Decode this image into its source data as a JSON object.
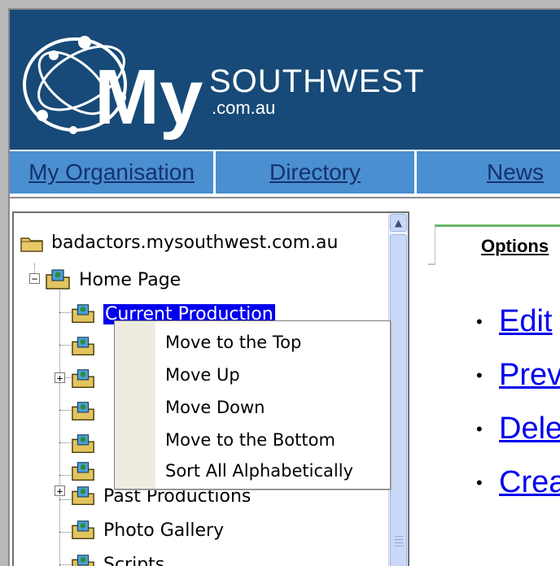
{
  "header": {
    "brand_my": "My",
    "brand_name": "SOUTHWEST",
    "brand_domain": ".com.au",
    "bg_color": "#174a78"
  },
  "nav": {
    "items": [
      {
        "label": "My Organisation"
      },
      {
        "label": "Directory"
      },
      {
        "label": "News"
      }
    ],
    "bar_color": "#4a8fd0"
  },
  "tree": {
    "root": {
      "label": "badactors.mysouthwest.com.au",
      "icon": "folder-icon"
    },
    "home": {
      "label": "Home Page",
      "icon": "page-folder-icon",
      "expanded": true
    },
    "children": [
      {
        "label": "Current Production",
        "selected": true
      },
      {
        "label": ""
      },
      {
        "label": "",
        "expandable": true
      },
      {
        "label": ""
      },
      {
        "label": ""
      },
      {
        "label": ""
      },
      {
        "label": "Past Productions",
        "expandable": true
      },
      {
        "label": "Photo Gallery"
      },
      {
        "label": "Scripts"
      }
    ]
  },
  "context_menu": {
    "items": [
      {
        "label": "Move to the Top"
      },
      {
        "label": "Move Up"
      },
      {
        "label": "Move Down"
      },
      {
        "label": "Move to the Bottom"
      },
      {
        "label": "Sort All Alphabetically"
      }
    ]
  },
  "right_panel": {
    "tab_label": "Options",
    "options": [
      {
        "label": "Edit"
      },
      {
        "label": "Prev"
      },
      {
        "label": "Dele"
      },
      {
        "label": "Crea"
      }
    ],
    "link_color": "#0000ee"
  }
}
